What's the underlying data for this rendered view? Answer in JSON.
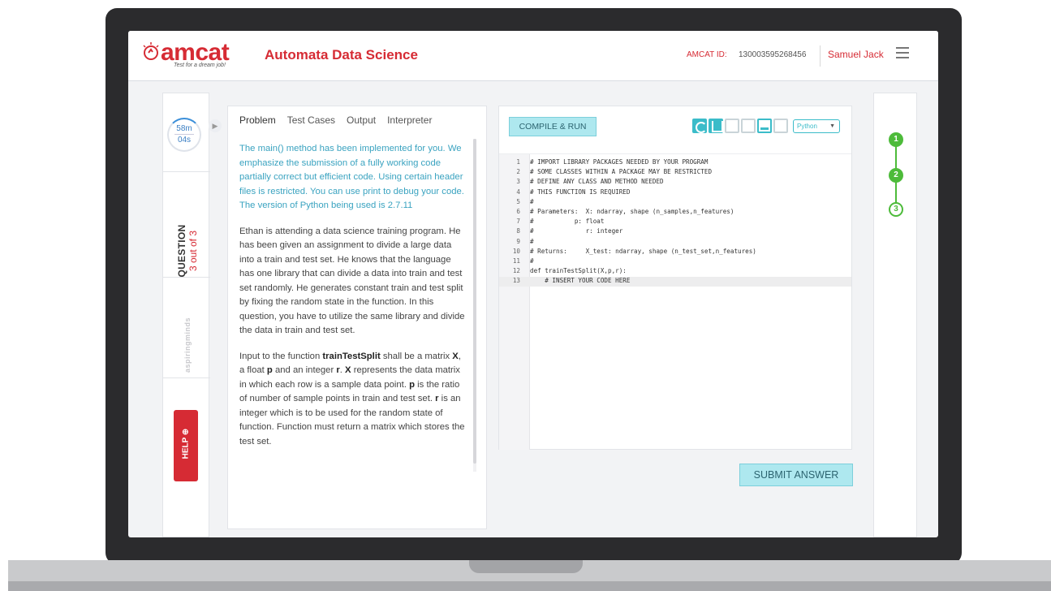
{
  "header": {
    "logo_text": "amcat",
    "logo_tagline": "Test for a dream job!",
    "app_title": "Automata Data Science",
    "amcat_id_label": "AMCAT ID:",
    "amcat_id_value": "130003595268456",
    "user_name": "Samuel Jack",
    "menu_icon": "hamburger-menu-icon"
  },
  "left_rail": {
    "timer_minutes": "58m",
    "timer_seconds": "04s",
    "question_word": "QUESTION",
    "question_count": "3 out of 3",
    "partner_logo": "aspiringminds",
    "help_label": "HELP"
  },
  "problem_panel": {
    "tabs": [
      {
        "label": "Problem",
        "active": true
      },
      {
        "label": "Test Cases",
        "active": false
      },
      {
        "label": "Output",
        "active": false
      },
      {
        "label": "Interpreter",
        "active": false
      }
    ],
    "note": "The main() method has been implemented for you. We emphasize the submission of a fully working code partially correct but efficient code. Using certain header files is restricted. You can use print to debug your code. The version of Python being used is 2.7.11",
    "paragraph1": "Ethan is attending a data science training program. He has been given  an assignment to divide a large data into a train and test set. He knows that the language has one library that can divide a data into train and test set randomly. He generates constant train and test split by fixing the random state in the function. In this question, you have to utilize the same library and divide the data in train and test set.",
    "paragraph2_parts": {
      "p1": "Input to the function ",
      "fn": "trainTestSplit",
      "p2": " shall be a matrix ",
      "x": "X",
      "p3": ", a float ",
      "p": "p",
      "p4": " and an integer ",
      "r": "r",
      "p5": ". ",
      "x2": "X",
      "p6": " represents the data matrix in which each row is a sample data point. ",
      "p_b": "p",
      "p7": " is the ratio of number of sample points in train and test set. ",
      "r_b": "r",
      "p8": " is an integer which is to be used for the random state of function. Function must return a matrix which stores the test set."
    }
  },
  "editor": {
    "compile_label": "COMPILE & RUN",
    "toolbar_icons": [
      "reset-icon",
      "save-icon",
      "fullscreen-icon",
      "layout-icon",
      "theme-icon",
      "split-icon"
    ],
    "language": "Python",
    "lines": [
      {
        "n": "1",
        "text": "# IMPORT LIBRARY PACKAGES NEEDED BY YOUR PROGRAM"
      },
      {
        "n": "2",
        "text": "# SOME CLASSES WITHIN A PACKAGE MAY BE RESTRICTED"
      },
      {
        "n": "3",
        "text": "# DEFINE ANY CLASS AND METHOD NEEDED"
      },
      {
        "n": "4",
        "text": "# THIS FUNCTION IS REQUIRED"
      },
      {
        "n": "5",
        "text": "#"
      },
      {
        "n": "6",
        "text": "# Parameters:  X: ndarray, shape (n_samples,n_features)"
      },
      {
        "n": "7",
        "text": "#           p: float"
      },
      {
        "n": "8",
        "text": "#              r: integer"
      },
      {
        "n": "9",
        "text": "#"
      },
      {
        "n": "10",
        "text": "# Returns:     X_test: ndarray, shape (n_test_set,n_features)"
      },
      {
        "n": "11",
        "text": "#"
      },
      {
        "n": "12",
        "text": "def trainTestSplit(X,p,r):"
      },
      {
        "n": "13",
        "text": "    # INSERT YOUR CODE HERE"
      }
    ],
    "submit_label": "SUBMIT ANSWER"
  },
  "progress": {
    "steps": [
      {
        "label": "1",
        "state": "done"
      },
      {
        "label": "2",
        "state": "done"
      },
      {
        "label": "3",
        "state": "current"
      }
    ]
  },
  "colors": {
    "brand_red": "#d62b34",
    "accent_cyan": "#3bbcc9",
    "note_blue": "#3aa3c0",
    "progress_green": "#4dbb3a"
  }
}
